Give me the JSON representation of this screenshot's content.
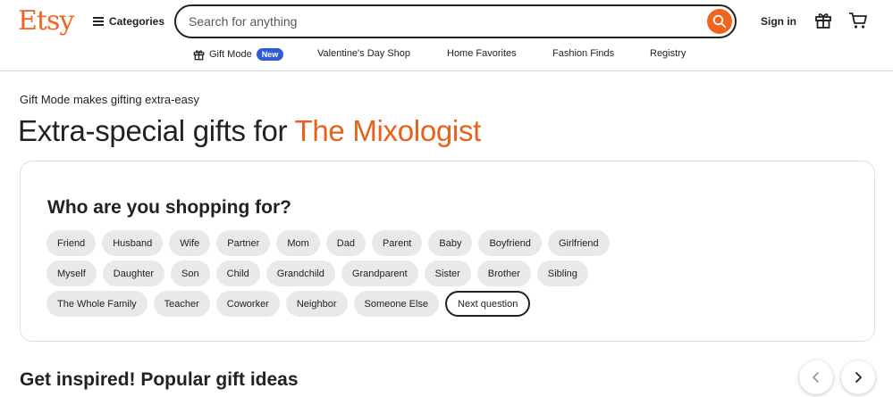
{
  "header": {
    "logo": "Etsy",
    "categories_label": "Categories",
    "search_placeholder": "Search for anything",
    "signin_label": "Sign in",
    "icons": {
      "menu": "hamburger-icon",
      "search": "search-icon",
      "gift": "gift-icon",
      "cart": "cart-icon"
    }
  },
  "subnav": {
    "gift_mode_label": "Gift Mode",
    "gift_mode_badge": "New",
    "items": [
      "Valentine's Day Shop",
      "Home Favorites",
      "Fashion Finds",
      "Registry"
    ]
  },
  "main": {
    "eyebrow": "Gift Mode makes gifting extra-easy",
    "headline_prefix": "Extra-special gifts for",
    "headline_accent": "The Mixologist",
    "question": "Who are you shopping for?",
    "chips_row1": [
      "Friend",
      "Husband",
      "Wife",
      "Partner",
      "Mom",
      "Dad",
      "Parent",
      "Baby",
      "Boyfriend",
      "Girlfriend"
    ],
    "chips_row2": [
      "Myself",
      "Daughter",
      "Son",
      "Child",
      "Grandchild",
      "Grandparent",
      "Sister",
      "Brother",
      "Sibling"
    ],
    "chips_row3": [
      "The Whole Family",
      "Teacher",
      "Coworker",
      "Neighbor",
      "Someone Else"
    ],
    "next_label": "Next question",
    "section_title": "Get inspired! Popular gift ideas"
  },
  "colors": {
    "brand": "#F1641E",
    "accent_text": "#E8601C",
    "new_badge": "#2F5BD8",
    "chip_bg": "#e9e9e9"
  }
}
